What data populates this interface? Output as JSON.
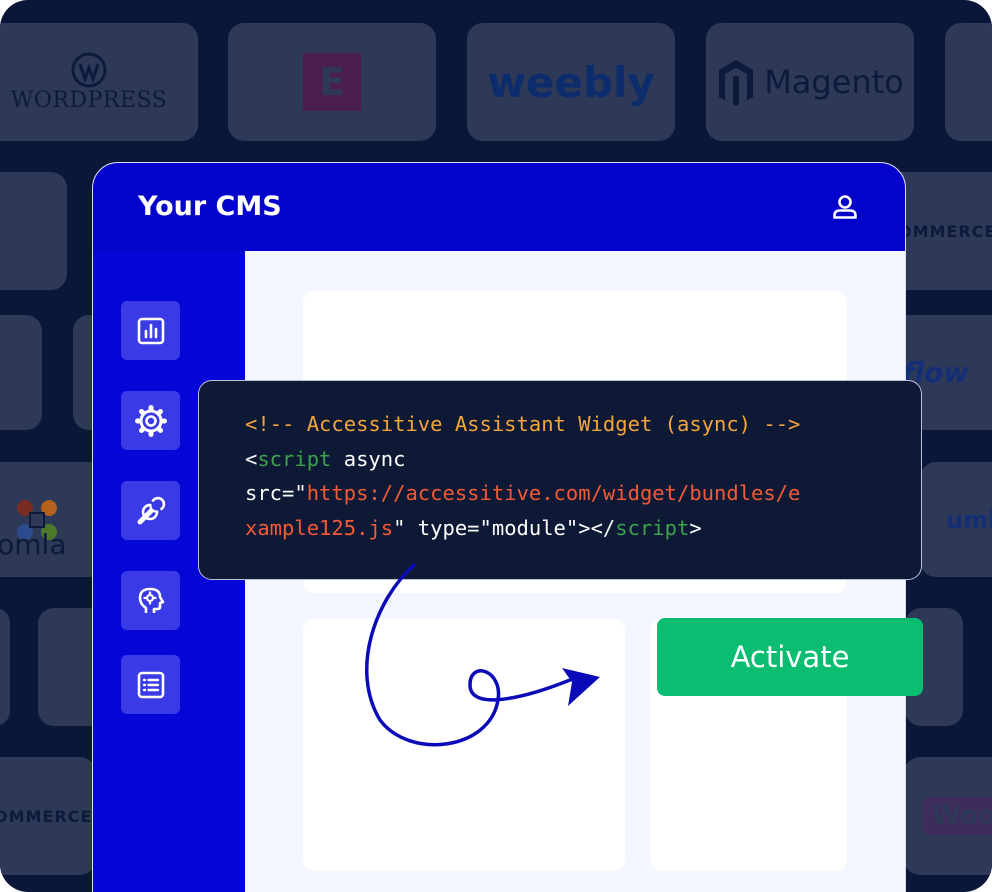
{
  "background_logos": [
    {
      "name": "wordpress",
      "text": "WordPress"
    },
    {
      "name": "elementor",
      "text": "E"
    },
    {
      "name": "weebly",
      "text": "weebly"
    },
    {
      "name": "magento",
      "text": "Magento"
    },
    {
      "name": "commerce-top",
      "text": "OMMERCE"
    },
    {
      "name": "webflow",
      "text": "flow"
    },
    {
      "name": "joomla",
      "text": "oomla"
    },
    {
      "name": "umbraco",
      "text": "umb"
    },
    {
      "name": "commerce-bottom",
      "text": "OMMERCE"
    },
    {
      "name": "woo",
      "text": "Woo"
    }
  ],
  "cms": {
    "title": "Your CMS",
    "user_icon": "user-icon",
    "sidebar_icons": [
      "analytics-icon",
      "settings-icon",
      "tools-icon",
      "ai-head-icon",
      "list-icon"
    ]
  },
  "code_snippet": {
    "comment": "<!-- Accessitive Assistant Widget (async) -->",
    "lt": "<",
    "tag": "script",
    "async_attr": " async",
    "src_attr": "src=\"",
    "url_line1": "https://accessitive.com/widget/bundles/e",
    "url_line2": "xample125.js",
    "after_url": "\" type=\"module\"></",
    "gt": ">"
  },
  "activate_label": "Activate",
  "colors": {
    "page_bg": "#0b1738",
    "tile": "#2d3956",
    "header": "#0303cc",
    "sidebar": "#0606d6",
    "accent_green": "#0bbd70",
    "code_bg": "#0e1936"
  }
}
